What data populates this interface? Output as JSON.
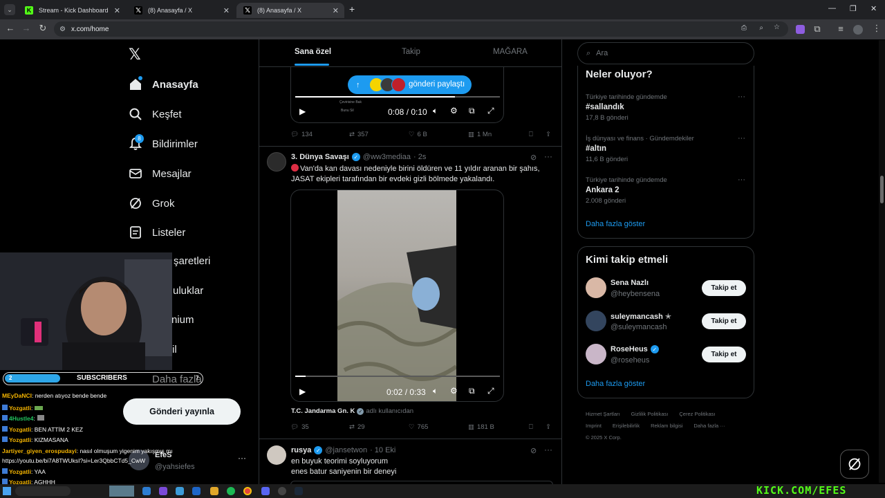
{
  "browser": {
    "tabs": [
      {
        "title": "Stream - Kick Dashboard"
      },
      {
        "title": "(8) Anasayfa / X"
      },
      {
        "title": "(8) Anasayfa / X"
      }
    ],
    "url": "x.com/home"
  },
  "nav": {
    "items": [
      {
        "label": "Anasayfa"
      },
      {
        "label": "Keşfet"
      },
      {
        "label": "Bildirimler",
        "badge": "8"
      },
      {
        "label": "Mesajlar"
      },
      {
        "label": "Grok"
      },
      {
        "label": "Listeler"
      },
      {
        "label": "şaretleri"
      },
      {
        "label": "uluklar"
      },
      {
        "label": "nium"
      },
      {
        "label": "il"
      },
      {
        "label": "Daha fazla"
      }
    ],
    "post_button": "Gönderi yayınla",
    "account": {
      "name": "EfeS",
      "handle": "@yahsiefes"
    }
  },
  "timeline": {
    "tabs": [
      "Sana özel",
      "Takip",
      "MAĞARA"
    ],
    "share_pill": "gönderi paylaştı",
    "top_video": {
      "time": "0:08 / 0:10",
      "caption1": "Çevirisine Bak",
      "caption2": "Bunu Sil"
    },
    "top_stats": {
      "replies": "134",
      "reposts": "357",
      "likes": "6 B",
      "views": "1 Mn"
    },
    "post1": {
      "author": "3. Dünya Savaşı",
      "handle": "@ww3mediaa",
      "time": "· 2s",
      "text1": "Van'da kan davası nedeniyle birini öldüren ve 11 yıldır aranan bir şahıs,",
      "text2": "JASAT ekipleri tarafından bir evdeki gizli bölmede yakalandı.",
      "video_time": "0:02 / 0:33",
      "source_name": "T.C. Jandarma Gn. K",
      "source_suffix": "adlı kullanıcıdan",
      "stats": {
        "replies": "35",
        "reposts": "29",
        "likes": "765",
        "views": "181 B"
      }
    },
    "post2": {
      "author": "rusya",
      "handle": "@jansetwon",
      "time": "· 10 Eki",
      "text1": "en buyuk teorimi soyluyorum",
      "text2": "enes batur saniyenin bir deneyi"
    }
  },
  "sidebar": {
    "search_placeholder": "Ara",
    "trends_title": "Neler oluyor?",
    "trends": [
      {
        "category": "Türkiye tarihinde gündemde",
        "name": "#sallandık",
        "count": "17,8 B gönderi"
      },
      {
        "category": "İş dünyası ve finans · Gündemdekiler",
        "name": "#altın",
        "count": "11,6 B gönderi"
      },
      {
        "category": "Türkiye tarihinde gündemde",
        "name": "Ankara 2",
        "count": "2.008 gönderi"
      }
    ],
    "show_more": "Daha fazla göster",
    "who_title": "Kimi takip etmeli",
    "who": [
      {
        "name": "Sena Nazlı",
        "handle": "@heybensena",
        "button": "Takip et"
      },
      {
        "name": "suleymancash ✭",
        "handle": "@suleymancash",
        "button": "Takip et"
      },
      {
        "name": "RoseHeus",
        "handle": "@roseheus",
        "button": "Takip et"
      }
    ],
    "who_more": "Daha fazla göster",
    "footer": {
      "line1": [
        "Hizmet Şartları",
        "Gizlilik Politikası",
        "Çerez Politikası"
      ],
      "line2": [
        "Imprint",
        "Erişilebilirlik",
        "Reklam bilgisi",
        "Daha fazla ···"
      ],
      "copyright": "© 2025 X Corp."
    }
  },
  "stream": {
    "sub_bar_count": "2",
    "sub_bar_label": "SUBSCRIBERS",
    "sub_bar_end": "7",
    "brand": "KICK.COM/EFES",
    "chat": [
      {
        "user": "MEyDaNCI",
        "msg": ": nerden atıyoz bende bende",
        "color": "#f4b400"
      },
      {
        "user": "Yozgatli",
        "msg": ":",
        "color": "#f4b400"
      },
      {
        "user": "4Hustle4",
        "msg": ":",
        "color": "#22c55e"
      },
      {
        "user": "Yozgatli",
        "msg": ": BEN ATTİM 2 KEZ",
        "color": "#f4b400"
      },
      {
        "user": "Yozgatli",
        "msg": ": KIZMASANA",
        "color": "#f4b400"
      },
      {
        "user": "Jartiyer_giyen_erospudayi",
        "msg": ": nasıl olmuşum yigenim yakışmış mı",
        "color": "#f4b400"
      },
      {
        "user": "",
        "msg": "https://youtu.be/bi7A8TWUksI?si=Ler3QbbCTd5_CwW",
        "color": "#ffffff"
      },
      {
        "user": "Yozgatli",
        "msg": ": YAA",
        "color": "#f4b400"
      },
      {
        "user": "Yozgatli",
        "msg": ": AGHHH",
        "color": "#f4b400"
      }
    ]
  },
  "colors": {
    "accent": "#1d9bf0",
    "kick_green": "#53fc18",
    "bg": "#000000",
    "border": "#2f3336"
  }
}
